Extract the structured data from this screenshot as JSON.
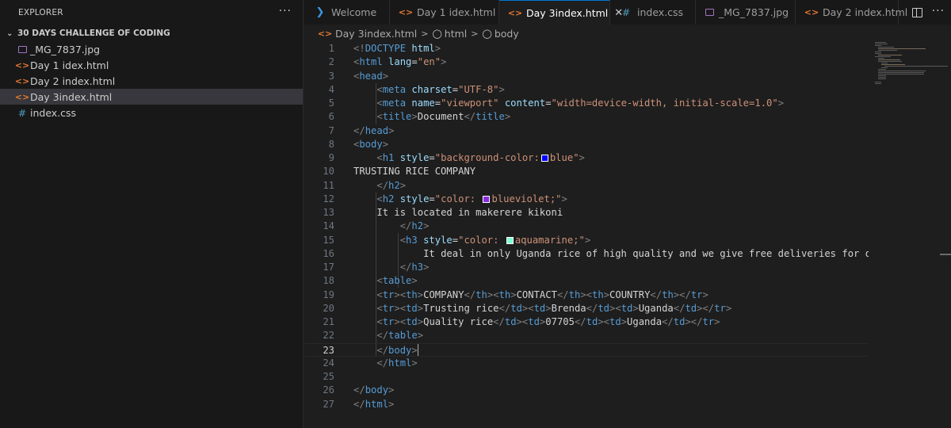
{
  "sidebar": {
    "title": "EXPLORER",
    "more": "···",
    "folder": "30 DAYS CHALLENGE OF CODING",
    "files": [
      {
        "label": "_MG_7837.jpg",
        "icon": "image-icon"
      },
      {
        "label": "Day 1 idex.html",
        "icon": "html-icon"
      },
      {
        "label": "Day 2 index.html",
        "icon": "html-icon"
      },
      {
        "label": "Day 3index.html",
        "icon": "html-icon",
        "active": true
      },
      {
        "label": "index.css",
        "icon": "css-icon"
      }
    ]
  },
  "tabs": [
    {
      "label": "Welcome",
      "icon": "vscode-icon"
    },
    {
      "label": "Day 1 idex.html",
      "icon": "html-icon"
    },
    {
      "label": "Day 3index.html",
      "icon": "html-icon",
      "active": true,
      "close": "✕"
    },
    {
      "label": "index.css",
      "icon": "css-icon"
    },
    {
      "label": "_MG_7837.jpg",
      "icon": "image-icon"
    },
    {
      "label": "Day 2 index.html",
      "icon": "html-icon"
    }
  ],
  "breadcrumb": {
    "file": "Day 3index.html",
    "html": "html",
    "body": "body"
  },
  "editor": {
    "current_line": 23,
    "line_numbers": [
      "1",
      "2",
      "3",
      "4",
      "5",
      "6",
      "7",
      "8",
      "9",
      "10",
      "11",
      "12",
      "13",
      "14",
      "15",
      "16",
      "17",
      "18",
      "19",
      "20",
      "21",
      "22",
      "23",
      "24",
      "25",
      "26",
      "27"
    ]
  },
  "colors": {
    "accent": "#0078d4",
    "swatch_blue": "#0000ff",
    "swatch_blueviolet": "#8a2be2",
    "swatch_aquamarine": "#7fffd4"
  }
}
